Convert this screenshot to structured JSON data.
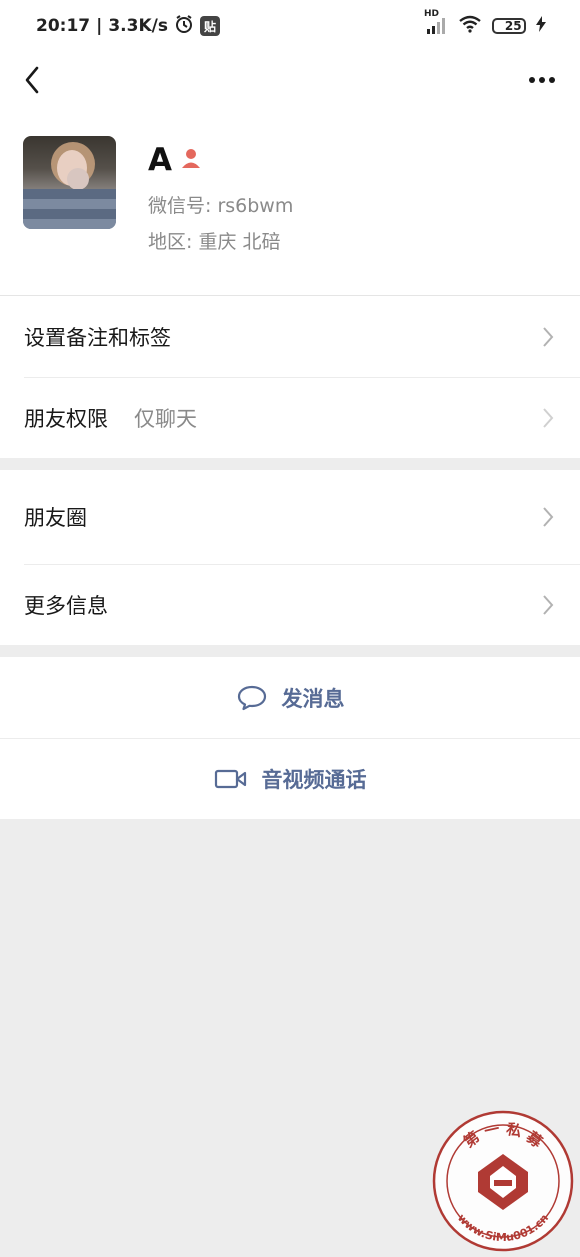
{
  "status_bar": {
    "time": "20:17",
    "speed": "3.3K/s",
    "tie_label": "贴",
    "battery": "25",
    "signal_label": "HD"
  },
  "profile": {
    "name": "A",
    "wechat_id": "微信号: rs6bwm",
    "region": "地区: 重庆  北碚"
  },
  "settings": {
    "remarks_label": "设置备注和标签",
    "permission_label": "朋友权限",
    "permission_value": "仅聊天",
    "moments_label": "朋友圈",
    "more_info_label": "更多信息"
  },
  "actions": {
    "message_label": "发消息",
    "call_label": "音视频通话"
  },
  "watermark": {
    "top_text": "第 一 私 募",
    "url_text": "www.SiMu001.cn"
  },
  "colors": {
    "link": "#576b95",
    "background": "#ededed",
    "watermark": "#b03a34",
    "gender_icon": "#e4685d"
  }
}
